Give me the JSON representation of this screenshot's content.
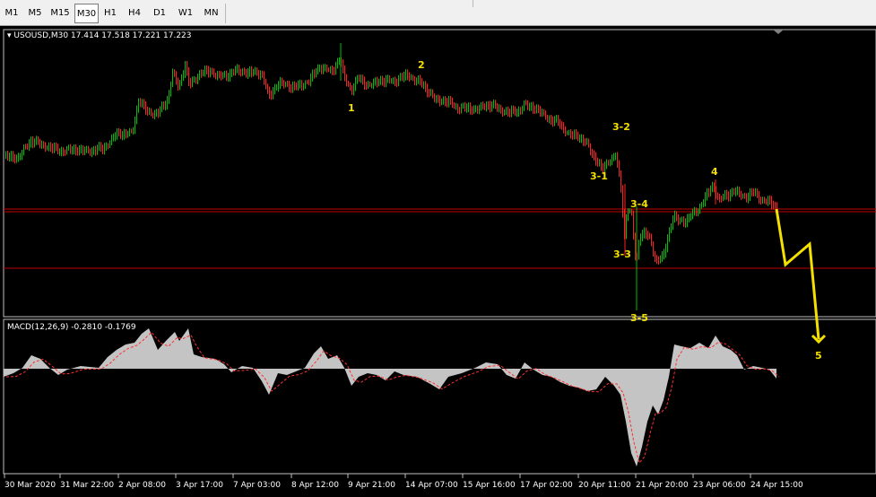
{
  "toolbar": {
    "timeframes": [
      "M1",
      "M5",
      "M15",
      "M30",
      "H1",
      "H4",
      "D1",
      "W1",
      "MN"
    ],
    "active": "M30"
  },
  "main_chart": {
    "header": "USOUSD,M30  17.414 17.518 17.221 17.223",
    "waves": [
      "1",
      "2",
      "3-1",
      "3-2",
      "3-3",
      "3-4",
      "3-5",
      "4",
      "5"
    ]
  },
  "macd": {
    "header": "MACD(12,26,9) -0.2810 -0.1769"
  },
  "time_axis": [
    "30 Mar 2020",
    "31 Mar 22:00",
    "2 Apr 08:00",
    "3 Apr 17:00",
    "7 Apr 03:00",
    "8 Apr 12:00",
    "9 Apr 21:00",
    "14 Apr 07:00",
    "15 Apr 16:00",
    "17 Apr 02:00",
    "20 Apr 11:00",
    "21 Apr 20:00",
    "23 Apr 06:00",
    "24 Apr 15:00"
  ],
  "colors": {
    "bull": "#00c000",
    "bear": "#ff2020",
    "hline": "#c00000",
    "wave": "#f4e000",
    "macd": "#c0c0c0"
  }
}
